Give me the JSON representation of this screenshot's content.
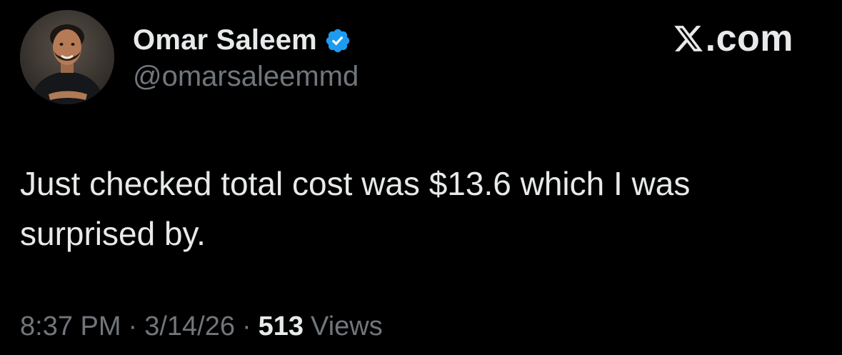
{
  "author": {
    "display_name": "Omar Saleem",
    "handle": "@omarsaleemmd",
    "verified": true
  },
  "brand": {
    "label": ".com",
    "icon": "x-logo-icon"
  },
  "tweet": {
    "text": "Just checked total cost was $13.6 which I was surprised by."
  },
  "meta": {
    "time": "8:37 PM",
    "separator": "·",
    "date": "3/14/26",
    "views_count": "513",
    "views_label": "Views"
  },
  "colors": {
    "background": "#000000",
    "primary_text": "#e7e9ea",
    "secondary_text": "#71767b",
    "verified_badge": "#1d9bf0"
  }
}
